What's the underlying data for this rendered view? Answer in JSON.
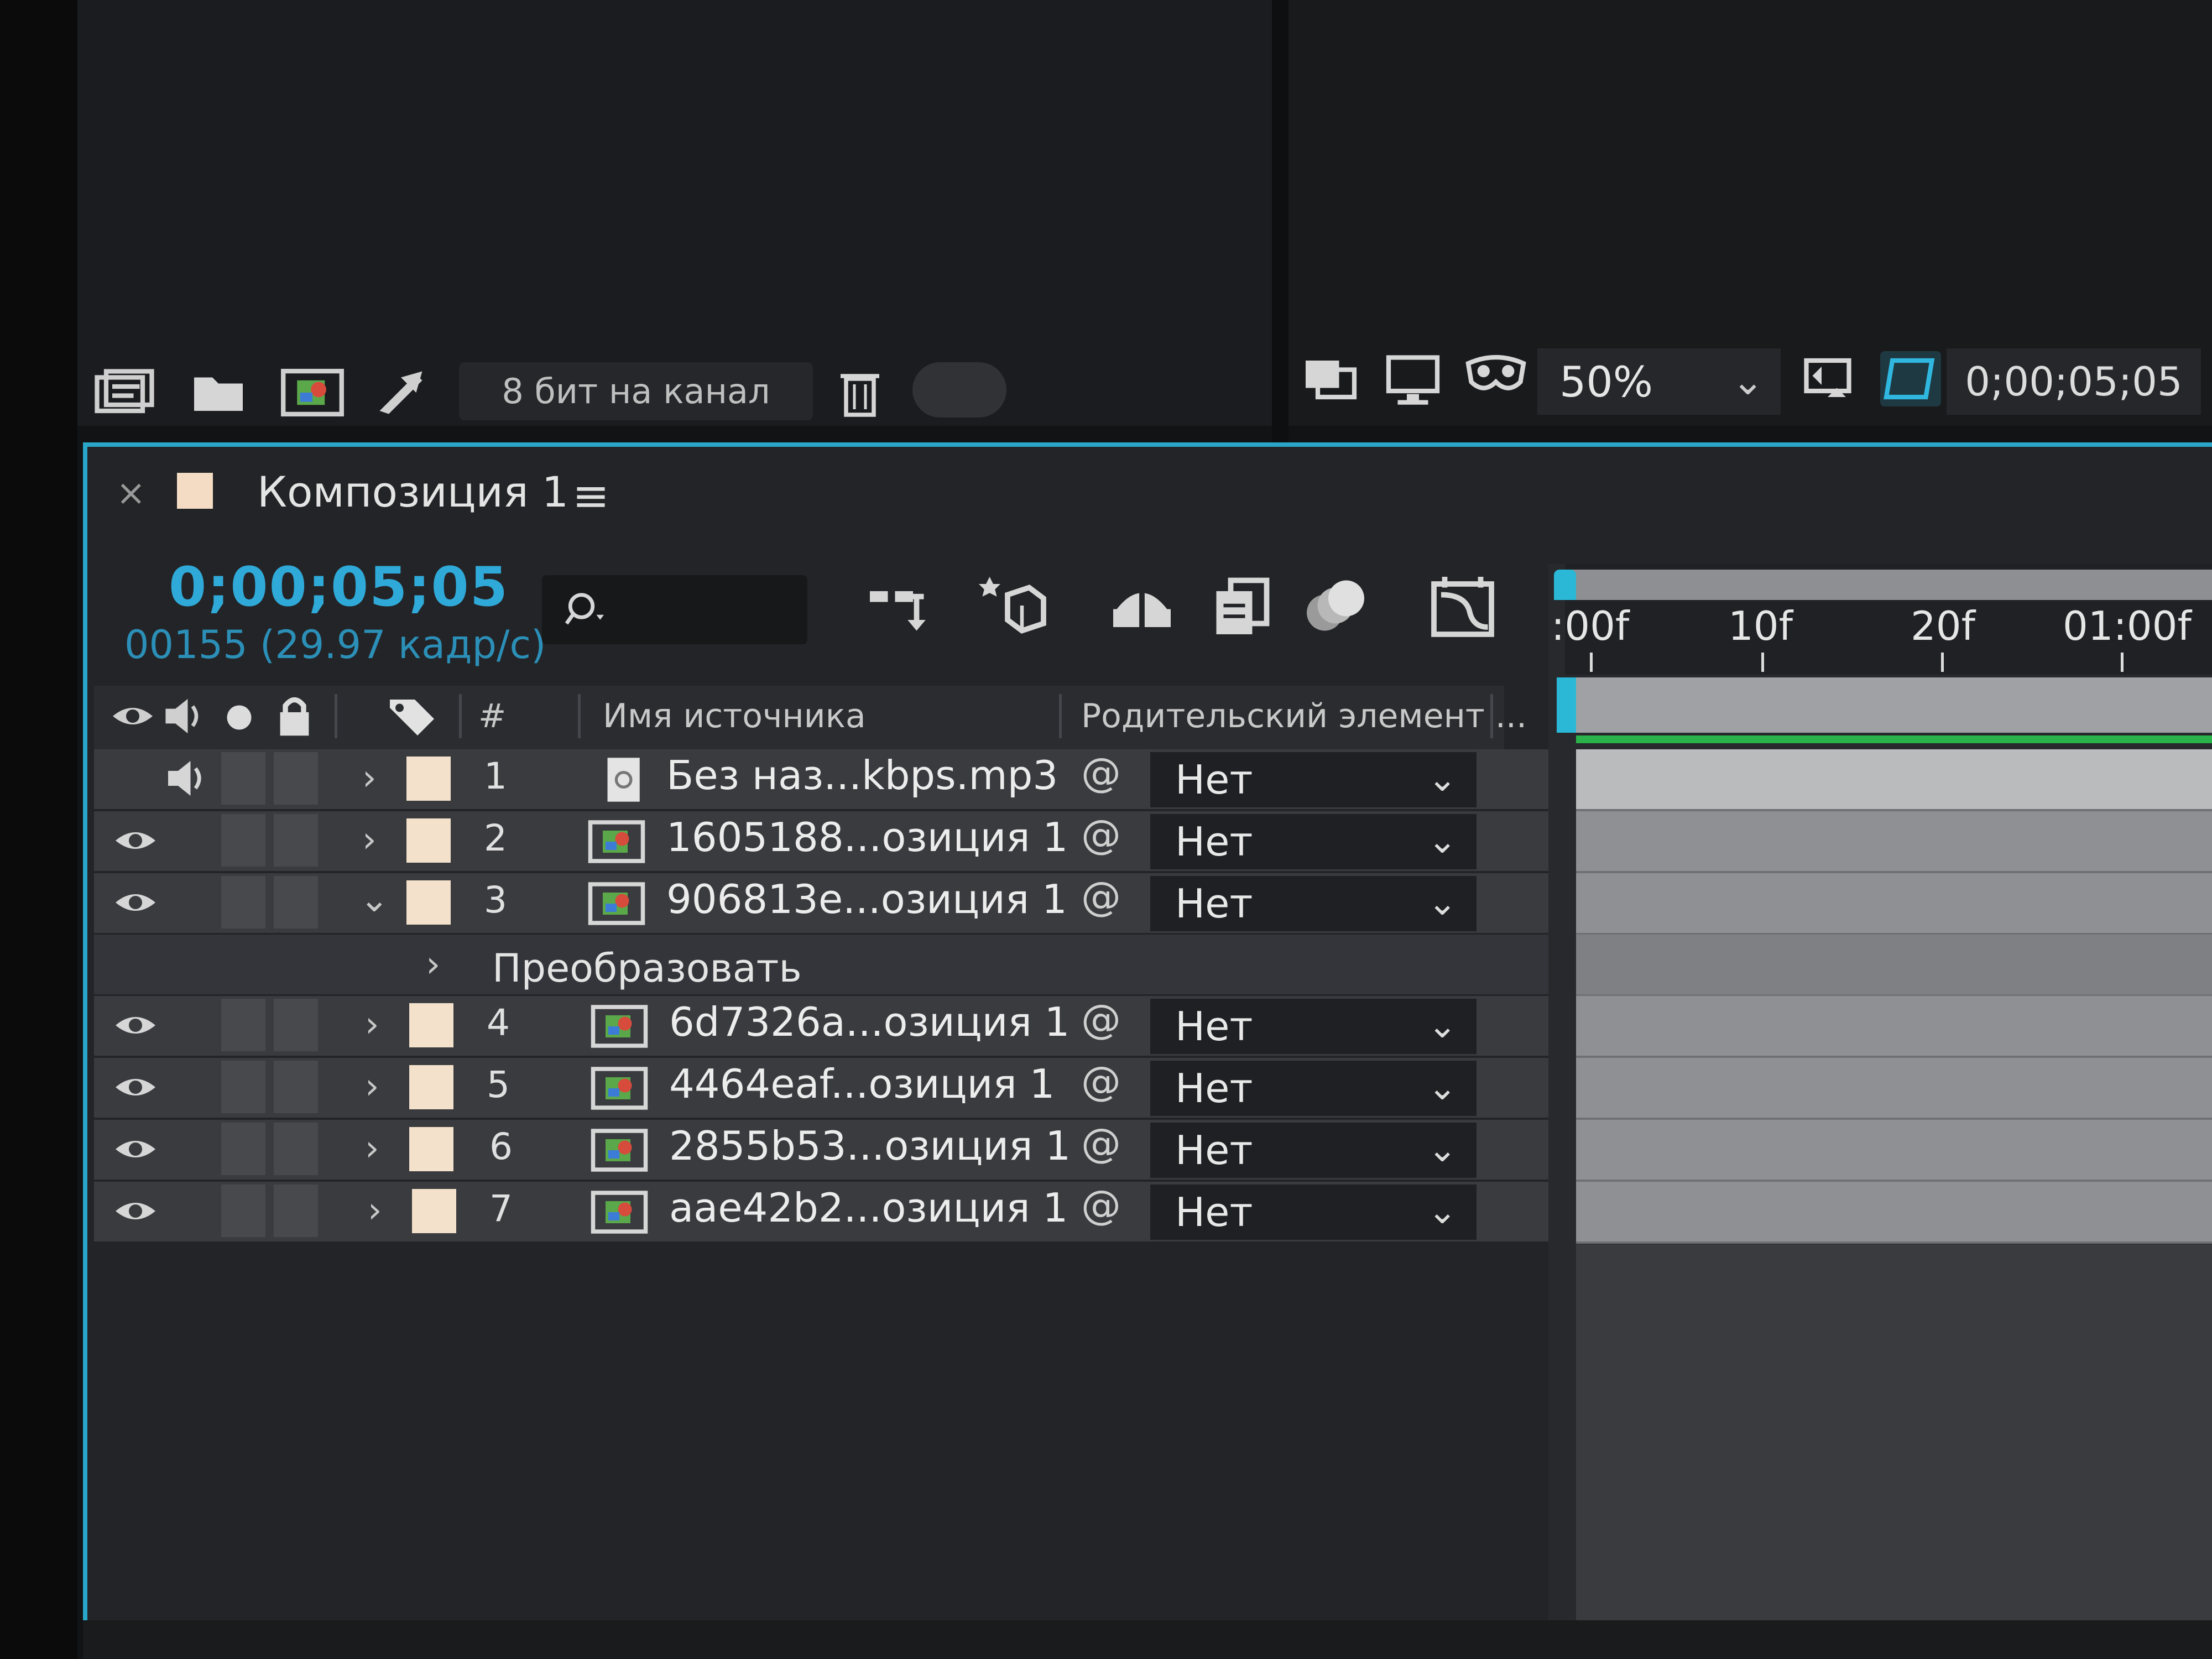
{
  "project_footer": {
    "bit_depth": "8 бит на канал",
    "icons": [
      "interpret-footage-icon",
      "folder-icon",
      "new-composition-icon",
      "flowchart-icon",
      "trash-icon"
    ]
  },
  "viewer_footer": {
    "zoom": "50%",
    "timecode": "0;00;05;05",
    "icons": [
      "snapshot-icon",
      "monitor-icon",
      "mask-visibility-icon",
      "region-of-interest-icon",
      "transparency-grid-icon"
    ]
  },
  "composition_tab": {
    "title": "Композиция 1",
    "close": "×",
    "menu": "≡"
  },
  "current_time": {
    "timecode": "0;00;05;05",
    "frames": "00155 (29.97 кадр/с)"
  },
  "timeline_tools": [
    "composition-flowchart-icon",
    "draft-3d-icon",
    "shy-layers-icon",
    "frame-blending-icon",
    "motion-blur-icon",
    "graph-editor-icon"
  ],
  "columns": {
    "number": "#",
    "source_name": "Имя источника",
    "parent": "Родительский элемент ..."
  },
  "layers": [
    {
      "num": "1",
      "name": "Без наз...kbps.mp3",
      "parent": "Нет",
      "type": "audio",
      "visible": false,
      "audio": true,
      "expanded": false
    },
    {
      "num": "2",
      "name": "1605188...озиция 1",
      "parent": "Нет",
      "type": "footage",
      "visible": true,
      "audio": false,
      "expanded": false
    },
    {
      "num": "3",
      "name": "906813e...озиция 1",
      "parent": "Нет",
      "type": "footage",
      "visible": true,
      "audio": false,
      "expanded": true
    },
    {
      "num": "4",
      "name": "6d7326a...озиция 1",
      "parent": "Нет",
      "type": "footage",
      "visible": true,
      "audio": false,
      "expanded": false
    },
    {
      "num": "5",
      "name": "4464eaf...озиция 1",
      "parent": "Нет",
      "type": "footage",
      "visible": true,
      "audio": false,
      "expanded": false
    },
    {
      "num": "6",
      "name": "2855b53...озиция 1",
      "parent": "Нет",
      "type": "footage",
      "visible": true,
      "audio": false,
      "expanded": false
    },
    {
      "num": "7",
      "name": "aae42b2...озиция 1",
      "parent": "Нет",
      "type": "footage",
      "visible": true,
      "audio": false,
      "expanded": false
    }
  ],
  "transform_group": {
    "label": "Преобразовать"
  },
  "ruler": {
    "ticks": [
      ":00f",
      "10f",
      "20f",
      "01:00f"
    ]
  },
  "colors": {
    "accent": "#2aa6c9",
    "timecode": "#2fa9d8",
    "work_area_green": "#29b34a",
    "label_swatch": "#f3e1cb"
  }
}
